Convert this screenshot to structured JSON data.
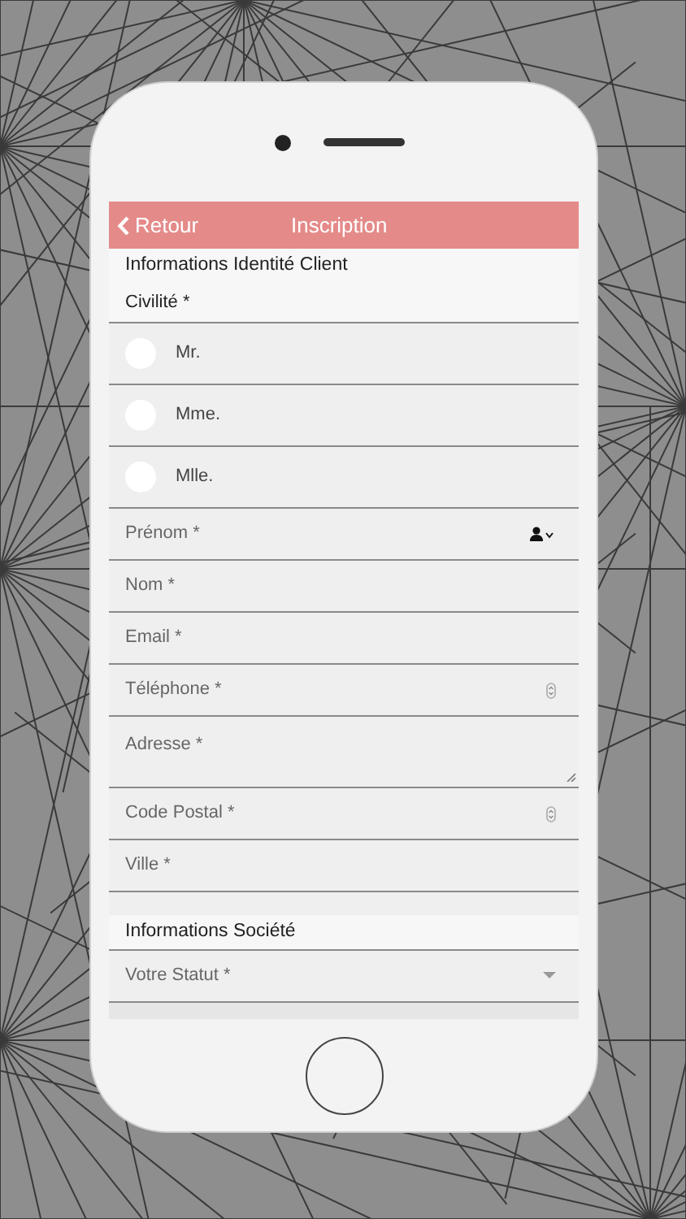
{
  "header": {
    "back": "Retour",
    "title": "Inscription"
  },
  "sections": [
    {
      "title": "Informations Identité Client",
      "label": "Civilité *",
      "radios": [
        {
          "label": "Mr.",
          "selected": false
        },
        {
          "label": "Mme.",
          "selected": false
        },
        {
          "label": "Mlle.",
          "selected": false
        }
      ],
      "fields": [
        {
          "kind": "contact",
          "placeholder": "Prénom *"
        },
        {
          "kind": "text",
          "placeholder": "Nom *"
        },
        {
          "kind": "text",
          "placeholder": "Email *"
        },
        {
          "kind": "number",
          "placeholder": "Téléphone *"
        },
        {
          "kind": "textarea",
          "placeholder": "Adresse *"
        },
        {
          "kind": "number",
          "placeholder": "Code Postal *"
        },
        {
          "kind": "text",
          "placeholder": "Ville *"
        }
      ]
    },
    {
      "title": "Informations Société",
      "fields": [
        {
          "kind": "select",
          "placeholder": "Votre Statut *"
        }
      ]
    }
  ]
}
